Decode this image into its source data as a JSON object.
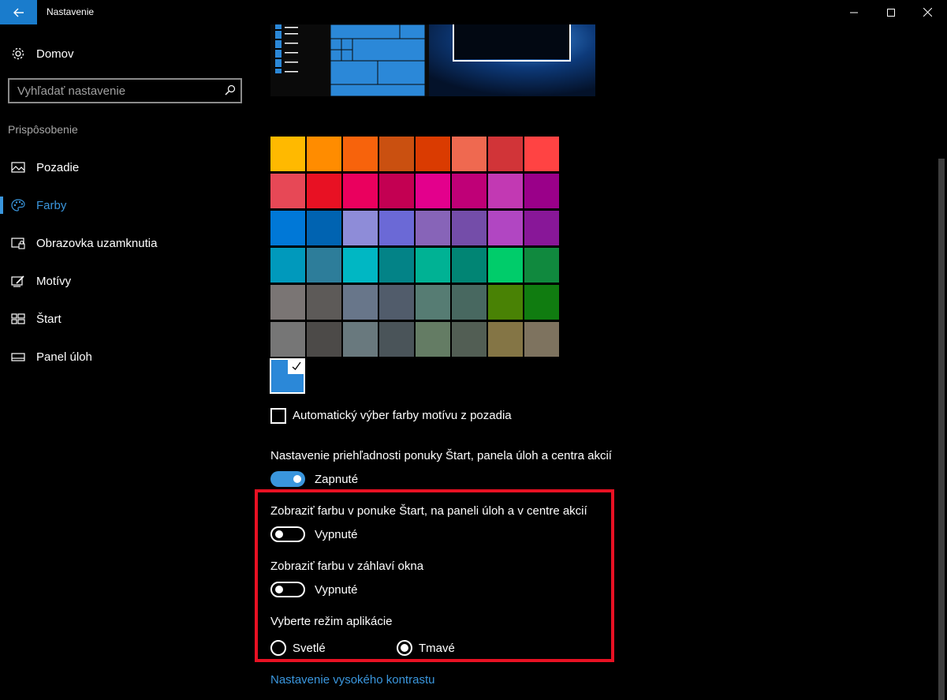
{
  "window": {
    "title": "Nastavenie"
  },
  "sidebar": {
    "home_label": "Domov",
    "search_placeholder": "Vyhľadať nastavenie",
    "section_label": "Prispôsobenie",
    "items": [
      {
        "label": "Pozadie",
        "icon": "picture-icon",
        "active": false
      },
      {
        "label": "Farby",
        "icon": "palette-icon",
        "active": true
      },
      {
        "label": "Obrazovka uzamknutia",
        "icon": "lock-screen-icon",
        "active": false
      },
      {
        "label": "Motívy",
        "icon": "themes-icon",
        "active": false
      },
      {
        "label": "Štart",
        "icon": "start-icon",
        "active": false
      },
      {
        "label": "Panel úloh",
        "icon": "taskbar-icon",
        "active": false
      }
    ]
  },
  "colors": {
    "accent": "#3a96dd",
    "selected_custom": "#2b88d8",
    "highlight_border": "#e81123",
    "swatches": [
      [
        "#ffb900",
        "#ff8c00",
        "#f7630c",
        "#ca5010",
        "#da3b01",
        "#ef6950",
        "#d13438",
        "#ff4343"
      ],
      [
        "#e74856",
        "#e81123",
        "#ea005e",
        "#c30052",
        "#e3008c",
        "#bf0077",
        "#c239b3",
        "#9a0089"
      ],
      [
        "#0078d7",
        "#0063b1",
        "#8e8cd8",
        "#6b69d6",
        "#8764b8",
        "#744da9",
        "#b146c2",
        "#881798"
      ],
      [
        "#0099bc",
        "#2d7d9a",
        "#00b7c3",
        "#038387",
        "#00b294",
        "#018574",
        "#00cc6a",
        "#10893e"
      ],
      [
        "#7a7574",
        "#5d5a58",
        "#68768a",
        "#515c6b",
        "#567c73",
        "#486860",
        "#498205",
        "#107c10"
      ],
      [
        "#767676",
        "#4c4a48",
        "#69797e",
        "#4a5459",
        "#647c64",
        "#525e54",
        "#847545",
        "#7e735f"
      ]
    ]
  },
  "main": {
    "auto_color_label": "Automatický výber farby motívu z pozadia",
    "auto_color_checked": false,
    "transparency_label": "Nastavenie priehľadnosti ponuky Štart, panela úloh a centra akcií",
    "transparency_state": "Zapnuté",
    "show_color_start_label": "Zobraziť farbu v ponuke Štart, na paneli úloh a v centre akcií",
    "show_color_start_state": "Vypnuté",
    "show_color_title_label": "Zobraziť farbu v záhlaví okna",
    "show_color_title_state": "Vypnuté",
    "app_mode_label": "Vyberte režim aplikácie",
    "app_mode_options": [
      "Svetlé",
      "Tmavé"
    ],
    "app_mode_selected": "Tmavé",
    "high_contrast_link": "Nastavenie vysokého kontrastu"
  }
}
